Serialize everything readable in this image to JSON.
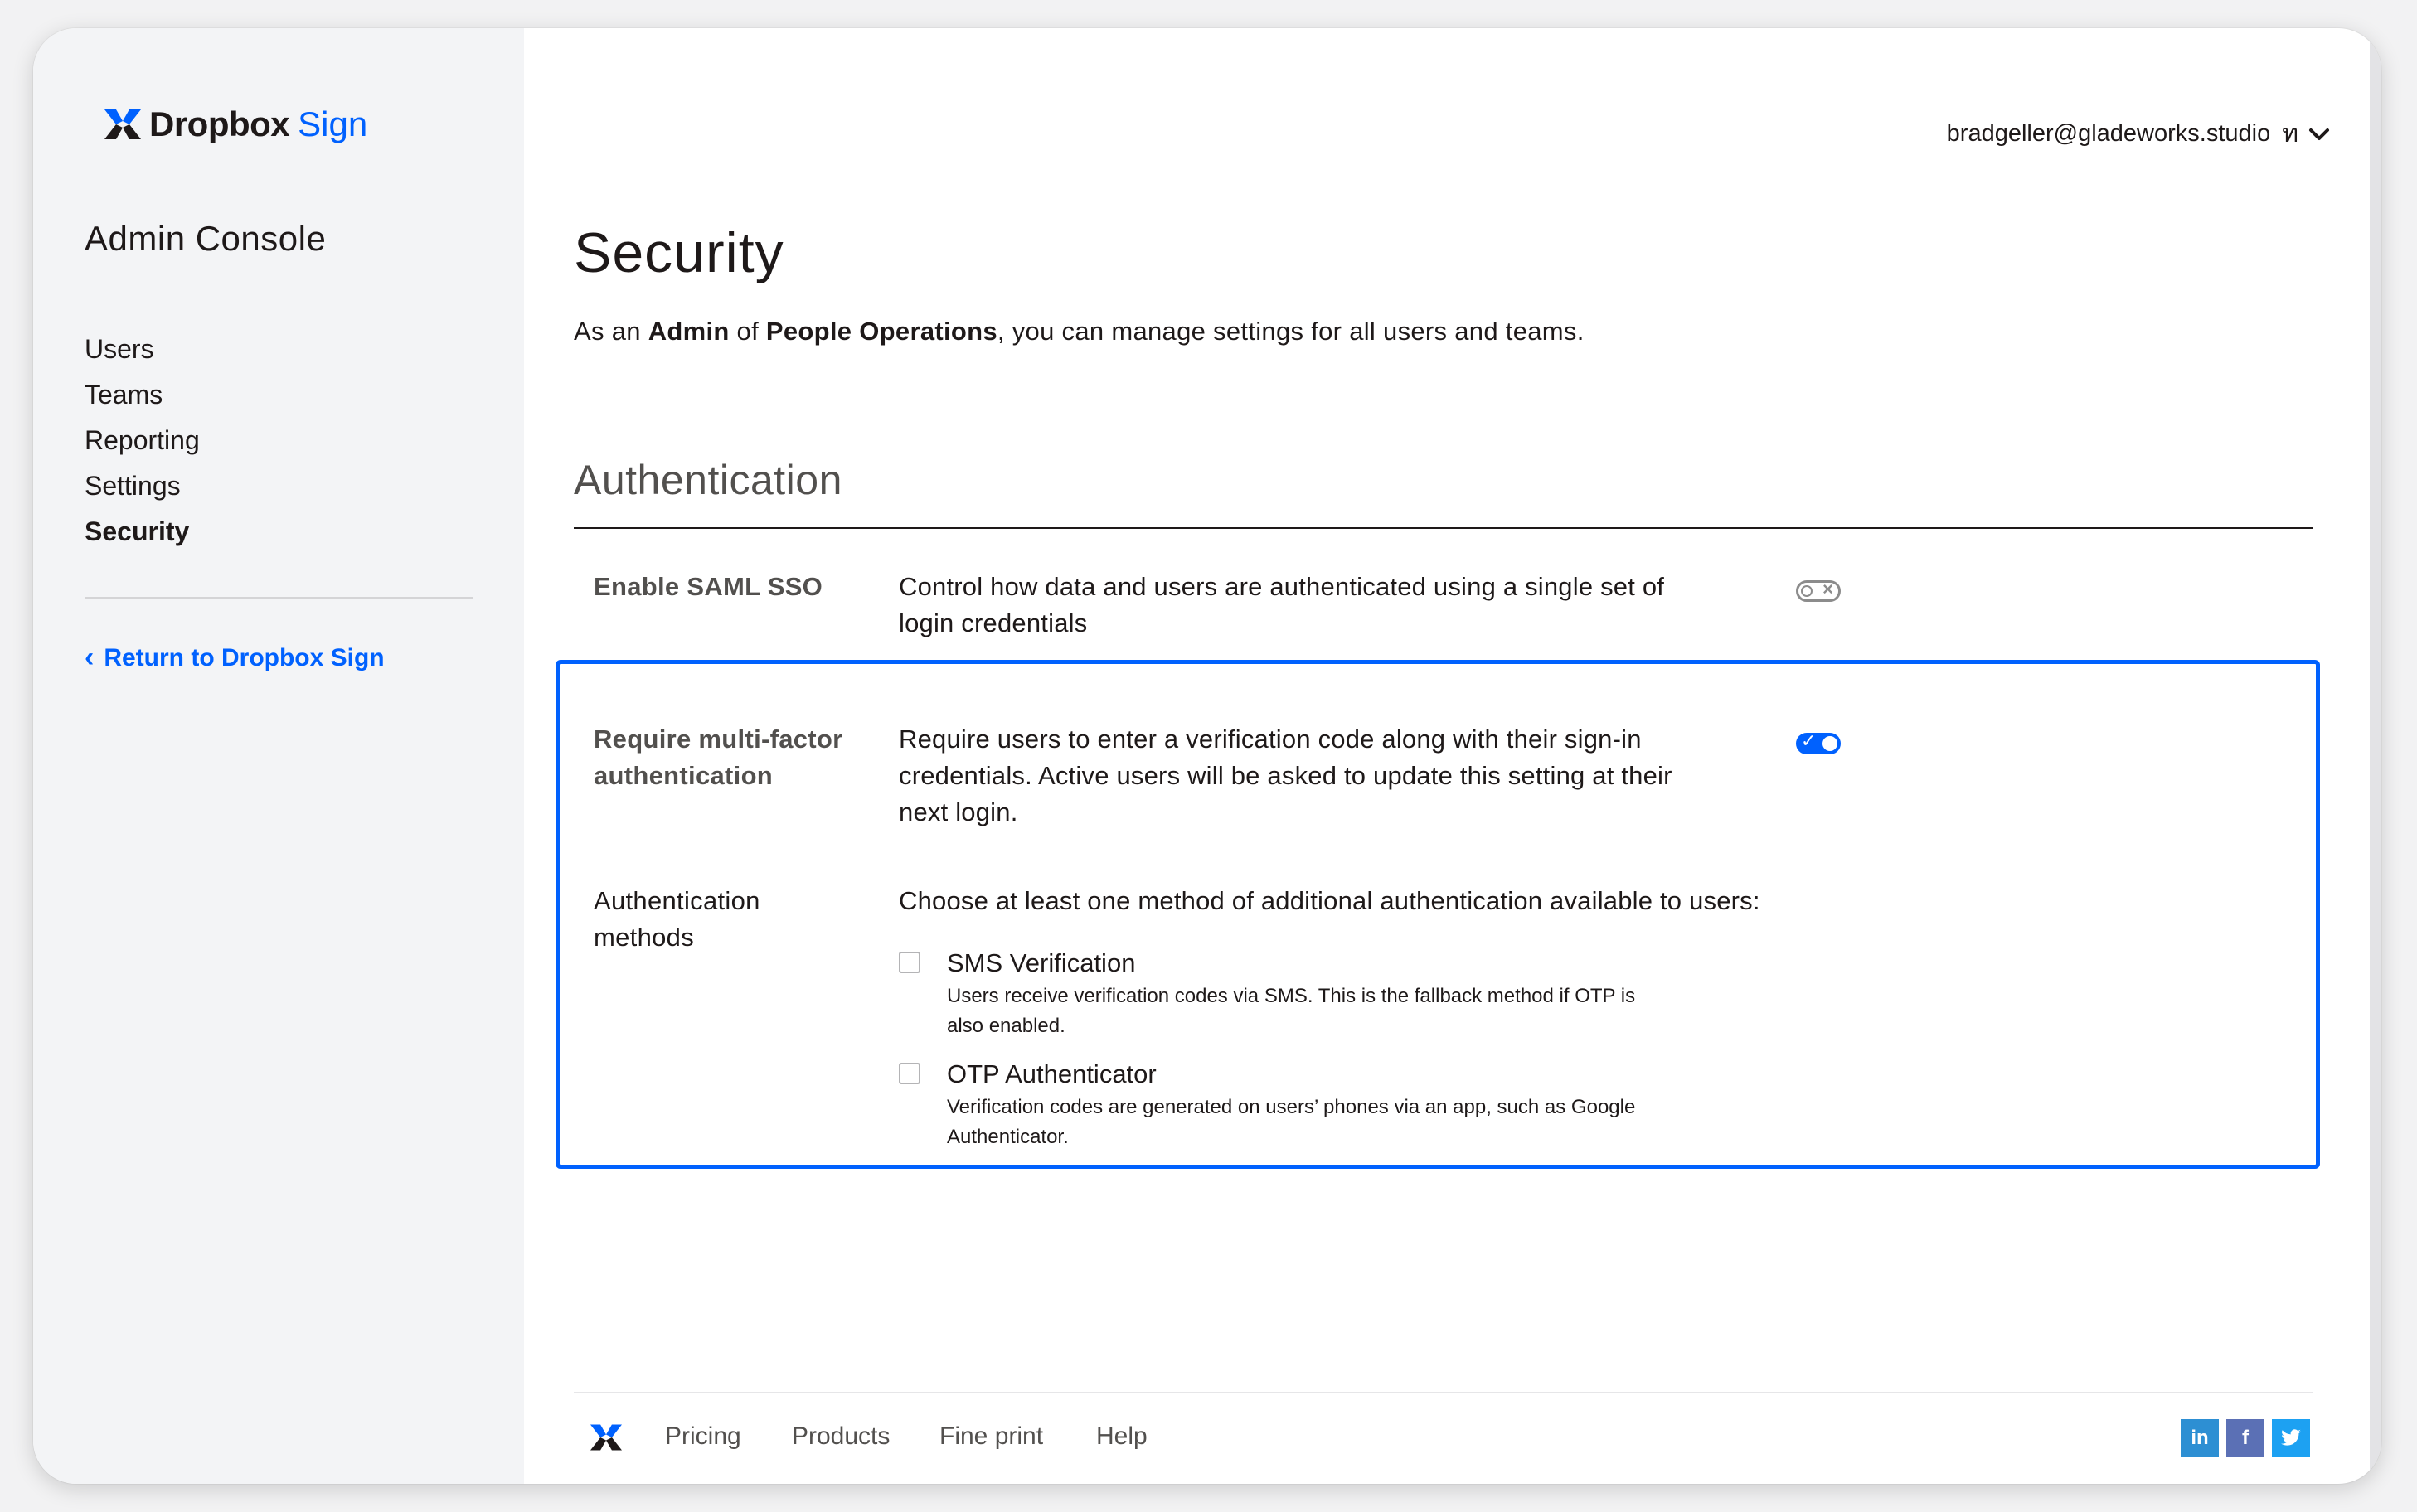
{
  "brand": {
    "name": "Dropbox",
    "product": "Sign"
  },
  "sidebar": {
    "title": "Admin Console",
    "items": [
      {
        "label": "Users"
      },
      {
        "label": "Teams"
      },
      {
        "label": "Reporting"
      },
      {
        "label": "Settings"
      },
      {
        "label": "Security",
        "active": true
      }
    ],
    "return_link": "Return to Dropbox Sign"
  },
  "header": {
    "account_email": "bradgeller@gladeworks.studio",
    "account_glyph": "ท"
  },
  "main": {
    "title": "Security",
    "desc_prefix": "As an ",
    "desc_role": "Admin",
    "desc_mid": " of ",
    "desc_team": "People Operations",
    "desc_suffix": ", you can manage settings for all users and teams.",
    "section_title": "Authentication",
    "saml": {
      "label": "Enable SAML SSO",
      "desc_line1": "Control how data and users are authenticated using a single set of",
      "desc_line2": "login credentials",
      "enabled": false
    },
    "mfa": {
      "label_line1": "Require multi-factor",
      "label_line2": "authentication",
      "desc_line1": "Require users to enter a verification code along with their sign-in",
      "desc_line2": "credentials. Active users will be asked to update this setting at their",
      "desc_line3": "next login.",
      "enabled": true
    },
    "methods": {
      "label_line1": "Authentication",
      "label_line2": "methods",
      "intro": "Choose at least one method of additional authentication available to users:",
      "sms": {
        "title": "SMS Verification",
        "help_line1": "Users receive verification codes via SMS. This is the fallback method if OTP is",
        "help_line2": "also enabled.",
        "checked": false
      },
      "otp": {
        "title": "OTP Authenticator",
        "help_line1": "Verification codes are generated on users’ phones via an app, such as Google",
        "help_line2": "Authenticator.",
        "checked": false
      }
    }
  },
  "footer": {
    "links": [
      "Pricing",
      "Products",
      "Fine print",
      "Help"
    ],
    "social": [
      {
        "icon": "linkedin-icon",
        "glyph": "in",
        "color": "#2d8fd3"
      },
      {
        "icon": "facebook-icon",
        "glyph": "f",
        "color": "#5b70b5"
      },
      {
        "icon": "twitter-icon",
        "glyph": "🐦",
        "color": "#1da1f2"
      }
    ]
  },
  "colors": {
    "accent": "#0061fe",
    "sidebar_bg": "#f3f4f6"
  }
}
